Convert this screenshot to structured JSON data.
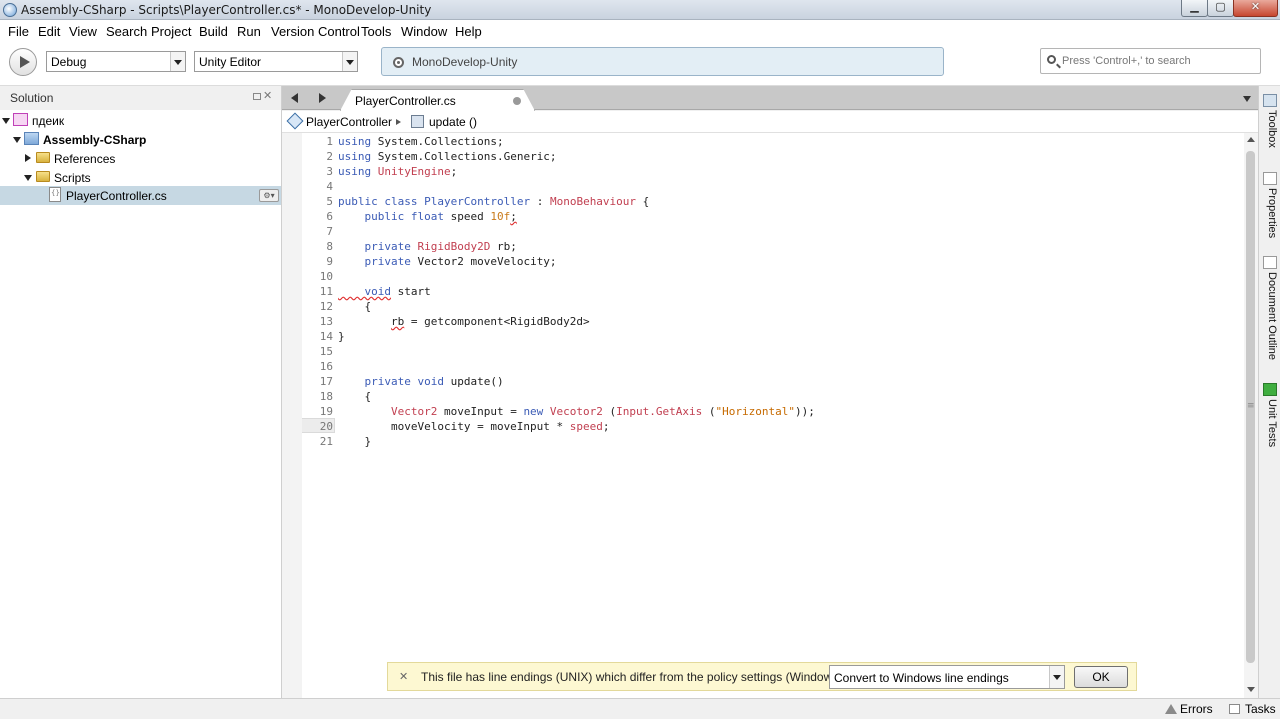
{
  "window": {
    "title": "Assembly-CSharp - Scripts\\PlayerController.cs* - MonoDevelop-Unity",
    "minimize_glyph": "▁",
    "maximize_glyph": "▢",
    "close_glyph": "✕"
  },
  "menu": [
    "File",
    "Edit",
    "View",
    "Search",
    "Project",
    "Build",
    "Run",
    "Version Control",
    "Tools",
    "Window",
    "Help"
  ],
  "toolbar": {
    "configuration": "Debug",
    "target": "Unity Editor",
    "status": "MonoDevelop-Unity",
    "search_placeholder": "Press 'Control+,' to search"
  },
  "solution": {
    "title": "Solution",
    "close_glyph": "✕",
    "tree": [
      {
        "label": "пдеик",
        "kind": "solution"
      },
      {
        "label": "Assembly-CSharp",
        "kind": "project"
      },
      {
        "label": "References",
        "kind": "folder"
      },
      {
        "label": "Scripts",
        "kind": "folder"
      },
      {
        "label": "PlayerController.cs",
        "kind": "file",
        "selected": true
      }
    ],
    "file_options_glyph": "⚙▾"
  },
  "editor": {
    "tab_label": "PlayerController.cs",
    "breadcrumb": {
      "class": "PlayerController",
      "method": "update ()"
    },
    "current_line": 20,
    "lines": [
      "1",
      "2",
      "3",
      "4",
      "5",
      "6",
      "7",
      "8",
      "9",
      "10",
      "11",
      "12",
      "13",
      "14",
      "15",
      "16",
      "17",
      "18",
      "19",
      "20",
      "21"
    ],
    "code": {
      "l1_kw": "using",
      "l1_rest": " System.Collections;",
      "l2_kw": "using",
      "l2_rest": " System.Collections.Generic;",
      "l3_kw": "using",
      "l3_ns": " UnityEngine",
      "l3_end": ";",
      "l5_kw": "public class",
      "l5_name": " PlayerController",
      "l5_colon": " : ",
      "l5_base": "MonoBehaviour",
      "l5_end": " {",
      "l6_kw": "    public float",
      "l6_name": " speed ",
      "l6_num": "10f",
      "l6_end": ";",
      "l8_kw": "    private",
      "l8_type": " RigidBody2D",
      "l8_end": " rb;",
      "l9_kw": "    private",
      "l9_rest": " Vector2 moveVelocity;",
      "l11_kw": "    void",
      "l11_rest": " start",
      "l12": "    {",
      "l13_indent": "        ",
      "l13_err": "rb",
      "l13_rest": " = getcomponent<RigidBody2d>",
      "l14": "}",
      "l17_kw": "    private void",
      "l17_rest": " update()",
      "l18": "    {",
      "l19_indent": "        ",
      "l19_type": "Vector2",
      "l19_mid": " moveInput = ",
      "l19_new": "new",
      "l19_type2": " Vecotor2",
      "l19_paren": " (",
      "l19_call": "Input.GetAxis",
      "l19_paren2": " (",
      "l19_str": "\"Horizontal\"",
      "l19_end": "));",
      "l20_rest": "        moveVelocity = moveInput * ",
      "l20_speed": "speed",
      "l20_end": ";",
      "l21": "    }"
    }
  },
  "right_dock": [
    "Toolbox",
    "Properties",
    "Document Outline",
    "Unit Tests"
  ],
  "infobar": {
    "close_glyph": "✕",
    "message": "This file has line endings (UNIX) which differ from the policy settings (Windows).",
    "option": "Convert to Windows line endings",
    "ok": "OK"
  },
  "statusbar": {
    "errors": "Errors",
    "tasks": "Tasks"
  },
  "scroll_grip": "≡"
}
